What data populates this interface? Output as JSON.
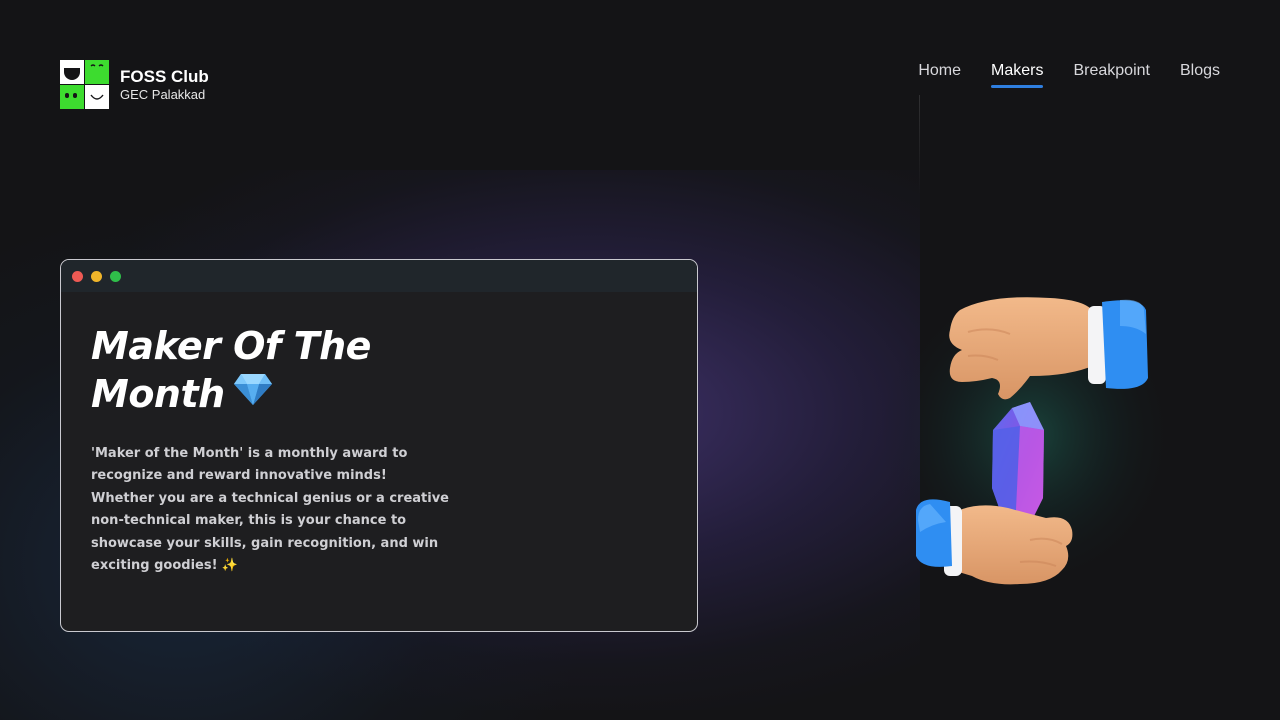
{
  "brand": {
    "name": "FOSS Club",
    "subtitle": "GEC Palakkad"
  },
  "nav": {
    "items": [
      {
        "label": "Home",
        "active": false
      },
      {
        "label": "Makers",
        "active": true
      },
      {
        "label": "Breakpoint",
        "active": false
      },
      {
        "label": "Blogs",
        "active": false
      }
    ]
  },
  "hero": {
    "title_line1": "Maker Of The",
    "title_line2": "Month",
    "title_icon": "gem-icon",
    "description": "'Maker of the Month' is a monthly award to recognize and reward innovative minds! Whether you are a technical genius or a creative non-technical maker, this is your chance to showcase your skills, gain recognition, and win exciting goodies!",
    "description_icon": "sparkles-icon"
  },
  "illustration": {
    "icon": "hands-passing-gem-icon"
  },
  "colors": {
    "accent": "#2f7fe0",
    "logo_green": "#3ddc2f",
    "background": "#141416",
    "card": "#1e1e20"
  }
}
